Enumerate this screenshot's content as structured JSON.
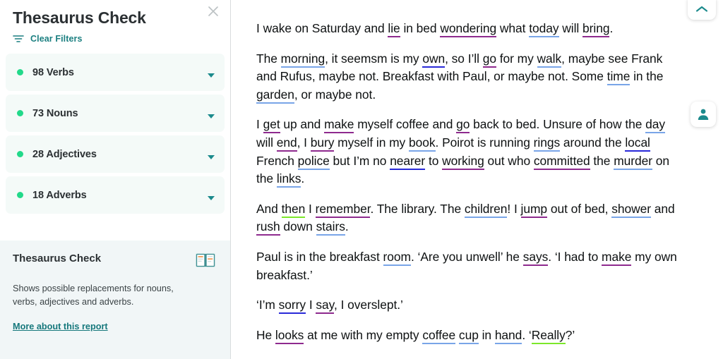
{
  "sidebar": {
    "title": "Thesaurus Check",
    "close_icon": "close-icon",
    "clear_filters": {
      "label": "Clear Filters",
      "icon": "filter-icon"
    },
    "filters": [
      {
        "label": "98 Verbs",
        "count": 98,
        "type": "Verbs",
        "dot_color": "#22d98a",
        "caret": "chevron-down-icon"
      },
      {
        "label": "73 Nouns",
        "count": 73,
        "type": "Nouns",
        "dot_color": "#22d98a",
        "caret": "chevron-down-icon"
      },
      {
        "label": "28 Adjectives",
        "count": 28,
        "type": "Adjectives",
        "dot_color": "#22d98a",
        "caret": "chevron-down-icon"
      },
      {
        "label": "18 Adverbs",
        "count": 18,
        "type": "Adverbs",
        "dot_color": "#22d98a",
        "caret": "chevron-down-icon"
      }
    ],
    "info": {
      "title": "Thesaurus Check",
      "icon": "open-book-icon",
      "description": "Shows possible replacements for nouns, verbs, adjectives and adverbs.",
      "link": "More about this report"
    }
  },
  "colors": {
    "accent_teal": "#1b7f80",
    "dot_green": "#22d98a",
    "verb_underline": "#8e2a8e",
    "noun_underline": "#79a5e8",
    "adjective_underline": "#2929d8",
    "adverb_underline": "#7ce82a",
    "filter_row_bg": "#f4faf8",
    "info_card_bg": "#f1f6f7"
  },
  "document": {
    "paragraphs": [
      [
        {
          "t": "I wake on Saturday and "
        },
        {
          "t": "lie",
          "m": "verb"
        },
        {
          "t": " in bed "
        },
        {
          "t": "wondering",
          "m": "verb"
        },
        {
          "t": " what "
        },
        {
          "t": "today",
          "m": "noun"
        },
        {
          "t": " will "
        },
        {
          "t": "bring",
          "m": "verb"
        },
        {
          "t": "."
        }
      ],
      [
        {
          "t": "The "
        },
        {
          "t": "morning",
          "m": "noun"
        },
        {
          "t": ", it seemsm is my "
        },
        {
          "t": "own",
          "m": "adjective"
        },
        {
          "t": ", so I’ll "
        },
        {
          "t": "go",
          "m": "verb"
        },
        {
          "t": " for my "
        },
        {
          "t": "walk",
          "m": "noun"
        },
        {
          "t": ", maybe see Frank and Rufus, maybe not. Breakfast with Paul, or maybe not. Some "
        },
        {
          "t": "time",
          "m": "noun"
        },
        {
          "t": " in the "
        },
        {
          "t": "garden",
          "m": "noun"
        },
        {
          "t": ", or maybe not."
        }
      ],
      [
        {
          "t": "I "
        },
        {
          "t": "get",
          "m": "verb"
        },
        {
          "t": " up and "
        },
        {
          "t": "make",
          "m": "verb"
        },
        {
          "t": " myself coffee and "
        },
        {
          "t": "go",
          "m": "verb"
        },
        {
          "t": " back to bed. Unsure of how the "
        },
        {
          "t": "day",
          "m": "noun"
        },
        {
          "t": " will "
        },
        {
          "t": "end",
          "m": "verb"
        },
        {
          "t": ", I "
        },
        {
          "t": "bury",
          "m": "verb"
        },
        {
          "t": " myself in my "
        },
        {
          "t": "book",
          "m": "noun"
        },
        {
          "t": ". Poirot is running "
        },
        {
          "t": "rings",
          "m": "noun"
        },
        {
          "t": " around the "
        },
        {
          "t": "local",
          "m": "adjective"
        },
        {
          "t": " French "
        },
        {
          "t": "police",
          "m": "noun"
        },
        {
          "t": " but I’m no "
        },
        {
          "t": "nearer",
          "m": "adjective"
        },
        {
          "t": " to "
        },
        {
          "t": "working",
          "m": "verb"
        },
        {
          "t": " out who "
        },
        {
          "t": "committed",
          "m": "verb"
        },
        {
          "t": " the "
        },
        {
          "t": "murder",
          "m": "noun"
        },
        {
          "t": " on the "
        },
        {
          "t": "links",
          "m": "noun"
        },
        {
          "t": "."
        }
      ],
      [
        {
          "t": "And "
        },
        {
          "t": "then",
          "m": "adverb"
        },
        {
          "t": " I "
        },
        {
          "t": "remember",
          "m": "verb"
        },
        {
          "t": ". The library. The "
        },
        {
          "t": "children",
          "m": "noun"
        },
        {
          "t": "! I "
        },
        {
          "t": "jump",
          "m": "verb"
        },
        {
          "t": " out of bed, "
        },
        {
          "t": "shower",
          "m": "noun"
        },
        {
          "t": " and "
        },
        {
          "t": "rush",
          "m": "verb"
        },
        {
          "t": " down "
        },
        {
          "t": "stairs",
          "m": "noun"
        },
        {
          "t": "."
        }
      ],
      [
        {
          "t": "Paul is in the breakfast "
        },
        {
          "t": "room",
          "m": "noun"
        },
        {
          "t": ". ‘Are you unwell’ he "
        },
        {
          "t": "says",
          "m": "verb"
        },
        {
          "t": ". ‘I had to "
        },
        {
          "t": "make",
          "m": "verb"
        },
        {
          "t": " my own breakfast.’"
        }
      ],
      [
        {
          "t": "‘I’m "
        },
        {
          "t": "sorry",
          "m": "adjective"
        },
        {
          "t": " I "
        },
        {
          "t": "say",
          "m": "verb"
        },
        {
          "t": ", I overslept.’"
        }
      ],
      [
        {
          "t": "He "
        },
        {
          "t": "looks",
          "m": "verb"
        },
        {
          "t": " at me with my empty "
        },
        {
          "t": "coffee",
          "m": "noun"
        },
        {
          "t": " "
        },
        {
          "t": "cup",
          "m": "noun"
        },
        {
          "t": " in "
        },
        {
          "t": "hand",
          "m": "noun"
        },
        {
          "t": ". ‘"
        },
        {
          "t": "Really",
          "m": "adverb"
        },
        {
          "t": "?’"
        }
      ]
    ]
  },
  "floating_buttons": [
    {
      "name": "scroll-to-top-button",
      "icon": "chevron-up-icon"
    },
    {
      "name": "account-button",
      "icon": "user-icon"
    }
  ]
}
